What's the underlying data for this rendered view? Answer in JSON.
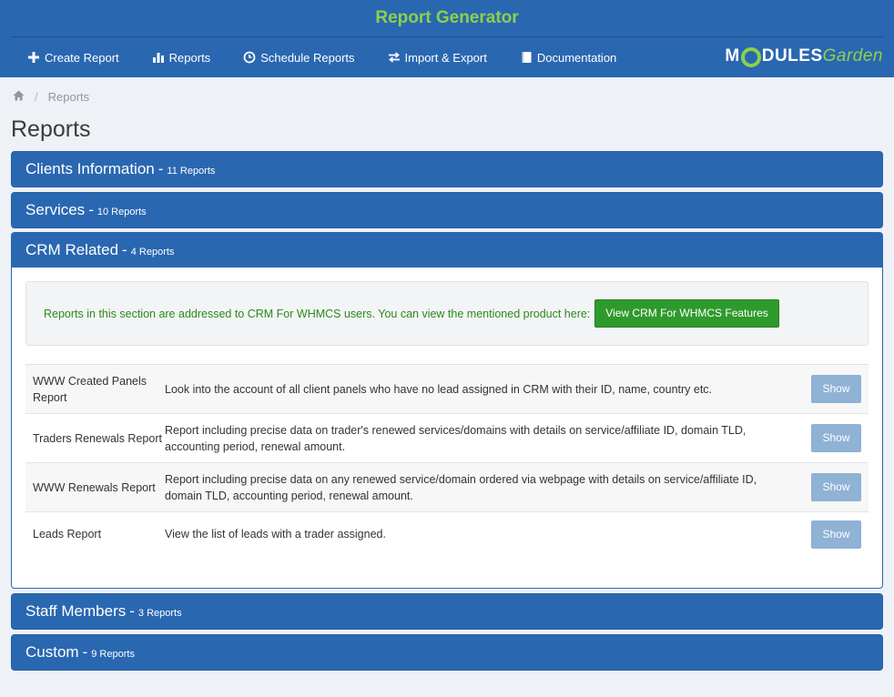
{
  "app": {
    "title": "Report Generator"
  },
  "nav": [
    {
      "icon": "plus-icon",
      "label": "Create Report"
    },
    {
      "icon": "bar-chart-icon",
      "label": "Reports"
    },
    {
      "icon": "clock-icon",
      "label": "Schedule Reports"
    },
    {
      "icon": "exchange-icon",
      "label": "Import & Export"
    },
    {
      "icon": "book-icon",
      "label": "Documentation"
    }
  ],
  "logo": {
    "part1": "M",
    "part2": "DULES",
    "part3": "Garden"
  },
  "breadcrumb": {
    "home_icon": "home-icon",
    "separator": "/",
    "current": "Reports"
  },
  "page": {
    "title": "Reports"
  },
  "panels": [
    {
      "title": "Clients Information",
      "dash": "-",
      "count": "11 Reports"
    },
    {
      "title": "Services",
      "dash": "-",
      "count": "10 Reports"
    },
    {
      "title": "CRM Related",
      "dash": "-",
      "count": "4 Reports",
      "notice": "Reports in this section are addressed to CRM For WHMCS users. You can view the mentioned product here:",
      "notice_button": "View CRM For WHMCS Features",
      "rows": [
        {
          "name": "WWW Created Panels Report",
          "desc": "Look into the account of all client panels who have no lead assigned in CRM with their ID, name, country etc.",
          "action": "Show"
        },
        {
          "name": "Traders Renewals Report",
          "desc": "Report including precise data on trader's renewed services/domains with details on service/affiliate ID, domain TLD, accounting period, renewal amount.",
          "action": "Show"
        },
        {
          "name": "WWW Renewals Report",
          "desc": "Report including precise data on any renewed service/domain ordered via webpage with details on service/affiliate ID, domain TLD, accounting period, renewal amount.",
          "action": "Show"
        },
        {
          "name": "Leads Report",
          "desc": "View the list of leads with a trader assigned.",
          "action": "Show"
        }
      ]
    },
    {
      "title": "Staff Members",
      "dash": "-",
      "count": "3 Reports"
    },
    {
      "title": "Custom",
      "dash": "-",
      "count": "9 Reports"
    }
  ],
  "colors": {
    "header": "#2a67b1",
    "accent_green": "#8bd14b",
    "button_green": "#2f9a2c",
    "show_button": "#8fb2d5"
  }
}
